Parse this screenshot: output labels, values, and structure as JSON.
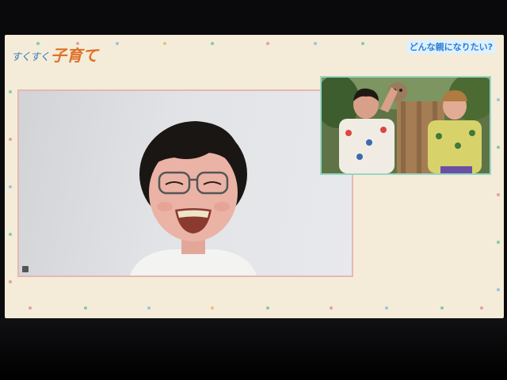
{
  "show": {
    "logo_small": "すくすく",
    "logo_big": "子育て",
    "corner_title": "どんな親になりたい?"
  },
  "main_video": {
    "participant": "video-caller"
  },
  "pip_video": {
    "participants": [
      "host-left",
      "host-right"
    ]
  },
  "icons": [
    "video-feed-indicator-icon"
  ],
  "colors": {
    "panel_background": "#f4ecd8",
    "main_frame_border": "#e6b7b2",
    "pip_frame_border": "#98d5c4",
    "title_blue": "#2d7fd0"
  }
}
